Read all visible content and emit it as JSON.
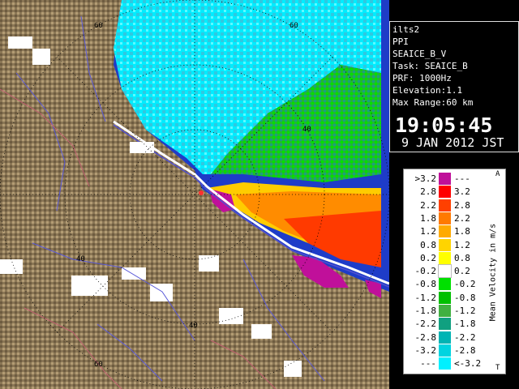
{
  "info": {
    "site": "ilts2",
    "product": "PPI",
    "scan": "SEAICE_B_V",
    "task": "Task: SEAICE_B",
    "prf": "PRF: 1000Hz",
    "elevation": "Elevation:1.1",
    "max_range": "Max Range:60 km",
    "time": "19:05:45",
    "date": "9 JAN 2012 JST"
  },
  "legend": {
    "title": "Mean Velocity in m/s",
    "top_marker": "A",
    "bottom_marker": "T",
    "rows": [
      {
        "lo": ">3.2",
        "hi": "---",
        "color": "#c0109a"
      },
      {
        "lo": "2.8",
        "hi": "3.2",
        "color": "#ff0000"
      },
      {
        "lo": "2.2",
        "hi": "2.8",
        "color": "#ff4000"
      },
      {
        "lo": "1.8",
        "hi": "2.2",
        "color": "#ff7a00"
      },
      {
        "lo": "1.2",
        "hi": "1.8",
        "color": "#ffaa00"
      },
      {
        "lo": "0.8",
        "hi": "1.2",
        "color": "#ffd400"
      },
      {
        "lo": "0.2",
        "hi": "0.8",
        "color": "#ffff00"
      },
      {
        "lo": "-0.2",
        "hi": "0.2",
        "color": "#ffffff"
      },
      {
        "lo": "-0.8",
        "hi": "-0.2",
        "color": "#00e000"
      },
      {
        "lo": "-1.2",
        "hi": "-0.8",
        "color": "#00c000"
      },
      {
        "lo": "-1.8",
        "hi": "-1.2",
        "color": "#40b040"
      },
      {
        "lo": "-2.2",
        "hi": "-1.8",
        "color": "#10a080"
      },
      {
        "lo": "-2.8",
        "hi": "-2.2",
        "color": "#00b4b4"
      },
      {
        "lo": "-3.2",
        "hi": "-2.8",
        "color": "#00d4e0"
      },
      {
        "lo": "---",
        "hi": "<-3.2",
        "color": "#00f0ff"
      }
    ]
  },
  "map": {
    "range_labels": [
      "60",
      "60",
      "40",
      "40",
      "40",
      "60"
    ],
    "colors": {
      "land": "#8c7a58",
      "sea_ice_cyan": "#00f0ff",
      "water": "#1e3cc8"
    }
  }
}
